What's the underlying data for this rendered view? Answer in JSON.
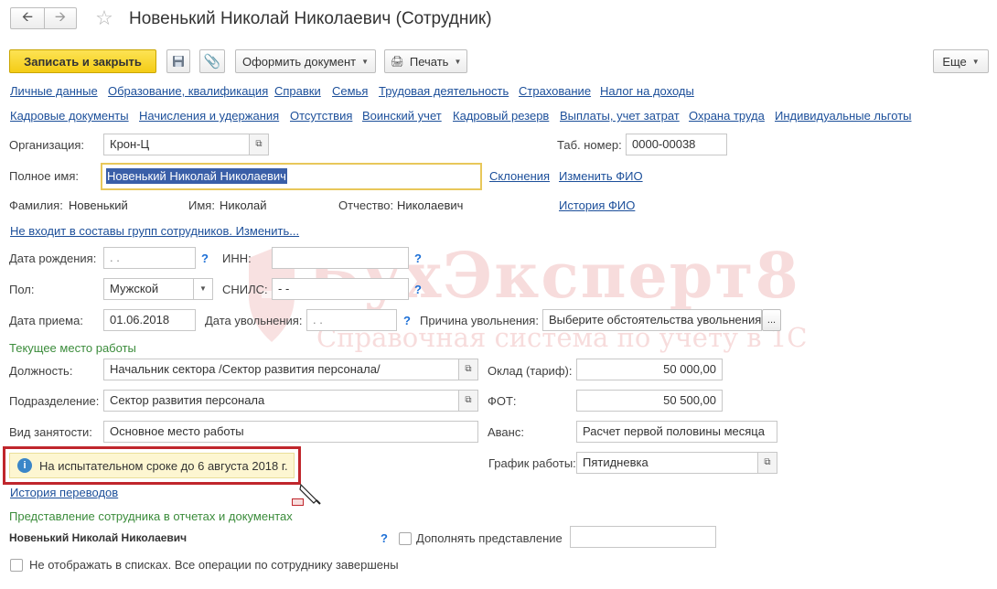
{
  "header": {
    "title": "Новенький Николай Николаевич (Сотрудник)",
    "back_icon": "arrow-left-icon",
    "forward_icon": "arrow-right-icon",
    "favorite_icon": "star-icon"
  },
  "toolbar": {
    "save_close": "Записать и закрыть",
    "create_doc": "Оформить документ",
    "print": "Печать",
    "more": "Еще"
  },
  "tabs_row1": [
    "Личные данные",
    "Образование, квалификация",
    "Справки",
    "Семья",
    "Трудовая деятельность",
    "Страхование",
    "Налог на доходы"
  ],
  "tabs_row2": [
    "Кадровые документы",
    "Начисления и удержания",
    "Отсутствия",
    "Воинский учет",
    "Кадровый резерв",
    "Выплаты, учет затрат",
    "Охрана труда",
    "Индивидуальные льготы"
  ],
  "form": {
    "org_label": "Организация:",
    "org_value": "Крон-Ц",
    "tab_label": "Таб. номер:",
    "tab_value": "0000-00038",
    "fullname_label": "Полное имя:",
    "fullname_value": "Новенький Николай Николаевич",
    "declension_link": "Склонения",
    "change_fio_link": "Изменить ФИО",
    "surname_label": "Фамилия:",
    "surname_value": "Новенький",
    "name_label": "Имя:",
    "name_value": "Николай",
    "patronymic_label": "Отчество:",
    "patronymic_value": "Николаевич",
    "history_fio_link": "История ФИО",
    "groups_link": "Не входит в составы групп сотрудников. Изменить...",
    "birth_label": "Дата рождения:",
    "birth_value": " .  .",
    "inn_label": "ИНН:",
    "inn_value": "",
    "gender_label": "Пол:",
    "gender_value": "Мужской",
    "snils_label": "СНИЛС:",
    "snils_value": "  -   -",
    "hire_label": "Дата приема:",
    "hire_value": "01.06.2018",
    "dismiss_label": "Дата увольнения:",
    "dismiss_value": " .  .",
    "reason_label": "Причина увольнения:",
    "reason_value": "Выберите обстоятельства увольнения.",
    "reason_btn": "...",
    "help_mark": "?"
  },
  "workplace": {
    "section_title": "Текущее место работы",
    "position_label": "Должность:",
    "position_value": "Начальник сектора /Сектор развития персонала/",
    "salary_label": "Оклад (тариф):",
    "salary_value": "50 000,00",
    "dept_label": "Подразделение:",
    "dept_value": "Сектор развития персонала",
    "fot_label": "ФОТ:",
    "fot_value": "50 500,00",
    "employment_label": "Вид занятости:",
    "employment_value": "Основное место работы",
    "advance_label": "Аванс:",
    "advance_value": "Расчет первой половины месяца",
    "probation_text": "На испытательном сроке до 6 августа 2018 г.",
    "schedule_label": "График работы:",
    "schedule_value": "Пятидневка",
    "transfers_link": "История переводов"
  },
  "representation": {
    "section_title": "Представление сотрудника в отчетах и документах",
    "name_value": "Новенький Николай Николаевич",
    "help_mark": "?",
    "supplement_label": "Дополнять представление",
    "supplement_value": ""
  },
  "footer": {
    "hide_label": "Не отображать в списках. Все операции по сотруднику завершены"
  },
  "watermark": {
    "brand": "БухЭксперт8",
    "tagline": "Справочная система по учету в 1С"
  },
  "colors": {
    "primary_button": "#f4cc16",
    "link": "#1c4f9a",
    "section_green": "#3b8c3b",
    "highlight_border": "#c0262c",
    "focus_border": "#e8c75a"
  }
}
